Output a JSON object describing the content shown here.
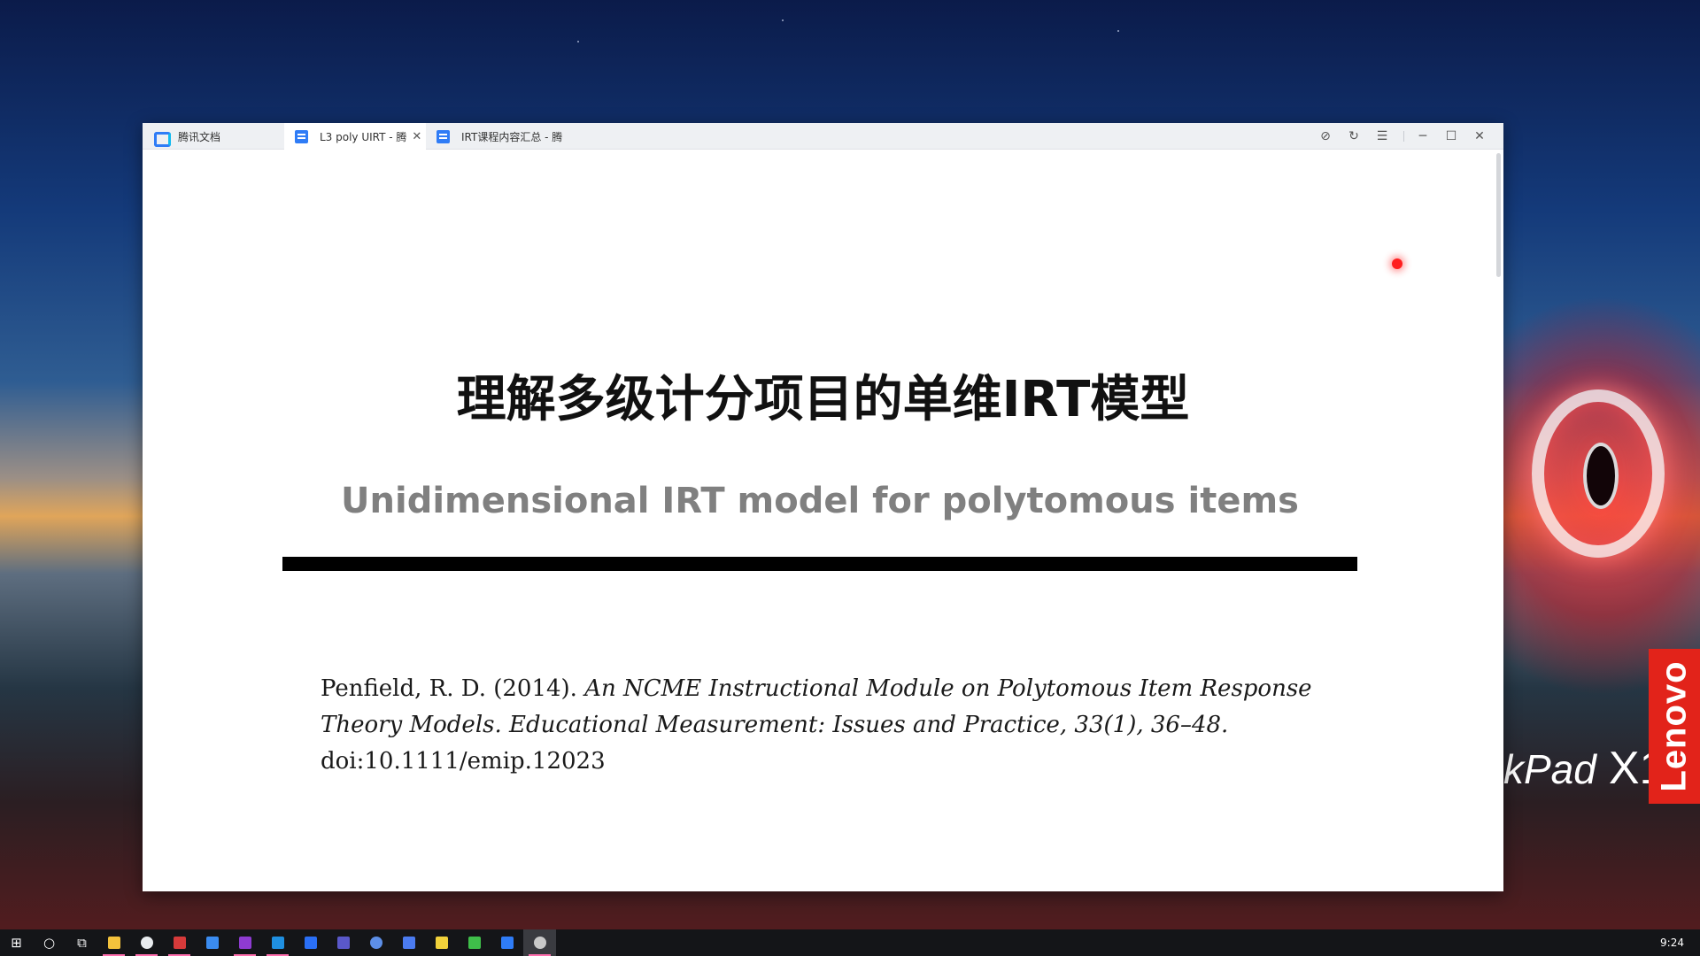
{
  "window": {
    "tabs": [
      {
        "label": "腾讯文档",
        "icon": "tencent-docs-icon"
      },
      {
        "label": "L3 poly UIRT - 腾",
        "icon": "document-icon",
        "active": true
      },
      {
        "label": "IRT课程内容汇总 - 腾",
        "icon": "document-icon"
      }
    ],
    "close_tab_glyph": "✕",
    "controls": {
      "timer_glyph": "⊘",
      "refresh_glyph": "↻",
      "menu_glyph": "☰",
      "minimize_glyph": "─",
      "maximize_glyph": "☐",
      "close_glyph": "✕"
    }
  },
  "document": {
    "title": "理解多级计分项目的单维IRT模型",
    "subtitle": "Unidimensional IRT model for polytomous items",
    "citation_author": "Penfield, R. D. (2014).",
    "citation_title": "An NCME Instructional Module on Polytomous Item Response Theory Models. Educational Measurement: Issues and Practice, 33(1), 36–48.",
    "citation_doi": "doi:10.1111/emip.12023"
  },
  "desktop": {
    "brand_badge": "Lenovo",
    "thinkpad_text": "kPad",
    "thinkpad_model": "X1"
  },
  "taskbar": {
    "clock": "9:24",
    "start_glyph": "⊞",
    "search_glyph": "○",
    "taskview_glyph": "⧉",
    "apps": [
      {
        "name": "file-explorer-icon",
        "color": "#f3c23c"
      },
      {
        "name": "cloud-app-icon",
        "color": "#e9ecef"
      },
      {
        "name": "mail-app-icon",
        "color": "#d63a3a"
      },
      {
        "name": "todo-app-icon",
        "color": "#3b8cf0"
      },
      {
        "name": "onenote-icon",
        "color": "#8e3bd1"
      },
      {
        "name": "edge-browser-icon",
        "color": "#1f8fe0"
      },
      {
        "name": "feather-app-icon",
        "color": "#2a6ff5"
      },
      {
        "name": "m-app-icon",
        "color": "#5a58c9"
      },
      {
        "name": "browser-circle-icon",
        "color": "#5d8fe8"
      },
      {
        "name": "chat-app-icon",
        "color": "#4b7bf0"
      },
      {
        "name": "sticky-notes-icon",
        "color": "#f2d23b"
      },
      {
        "name": "wechat-icon",
        "color": "#3fbf4a"
      },
      {
        "name": "tencent-docs-taskbar-icon",
        "color": "#2f7cf6"
      },
      {
        "name": "clock-app-icon",
        "color": "#c9c9c9"
      }
    ],
    "accent": "#ff6fae"
  }
}
